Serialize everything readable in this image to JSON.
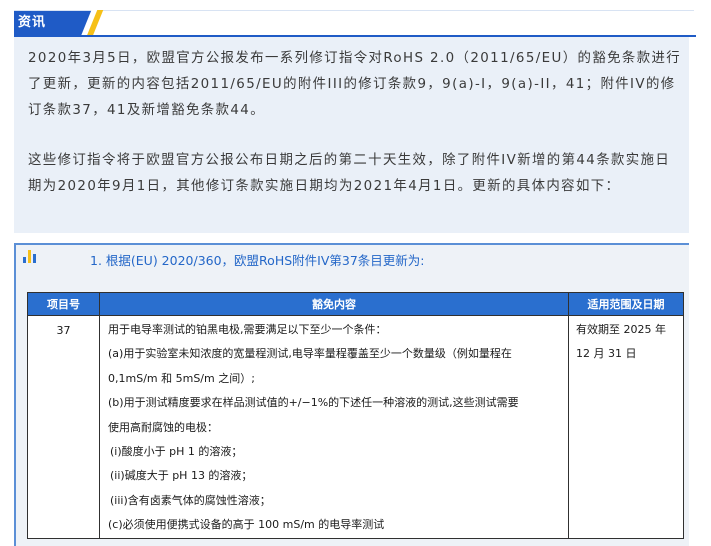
{
  "section": {
    "tag_label": "资讯"
  },
  "info": {
    "paragraphs": [
      "2020年3月5日，欧盟官方公报发布一系列修订指令对RoHS 2.0（2011/65/EU）的豁免条款进行了更新，更新的内容包括2011/65/EU的附件III的修订条款9，9(a)-I，9(a)-II，41；附件IV的修订条款37，41及新增豁免条款44。",
      "这些修订指令将于欧盟官方公报公布日期之后的第二十天生效，除了附件IV新增的第44条款实施日期为2020年9月1日，其他修订条款实施日期均为2021年4月1日。更新的具体内容如下："
    ]
  },
  "law": {
    "title": "1. 根据(EU) 2020/360，欧盟RoHS附件IV第37条目更新为:",
    "icon": "bar-chart-icon",
    "accent_color": "#2a6fcf",
    "table": {
      "headers": [
        "项目号",
        "豁免内容",
        "适用范围及日期"
      ],
      "row": {
        "id": "37",
        "lines": [
          "用于电导率测试的铂黑电极,需要满足以下至少一个条件：",
          "(a)用于实验室未知浓度的宽量程测试,电导率量程覆盖至少一个数量级（例如量程在",
          "0,1mS/m 和 5mS/m 之间）;",
          "(b)用于测试精度要求在样品测试值的+/−1%的下述任一种溶液的测试,这些测试需要",
          "使用高耐腐蚀的电极：",
          "(i)酸度小于 pH 1 的溶液；",
          "(ii)碱度大于 pH 13 的溶液；",
          "(iii)含有卤素气体的腐蚀性溶液；",
          "(c)必须使用便携式设备的高于 100  mS/m 的电导率测试"
        ],
        "date_lines": [
          "有效期至 2025 年",
          "12 月 31 日"
        ]
      }
    }
  }
}
